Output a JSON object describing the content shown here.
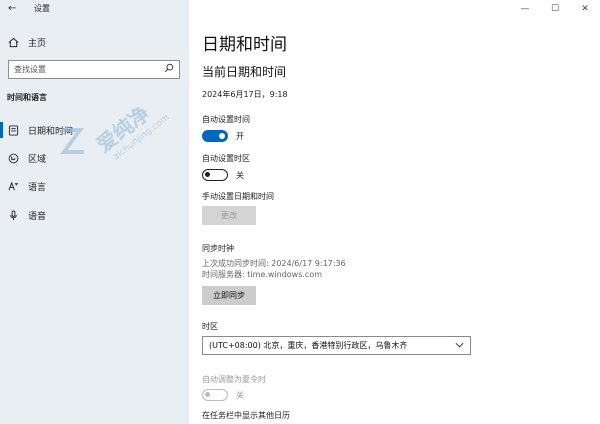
{
  "app": {
    "title": "设置"
  },
  "window": {
    "minimize": "—",
    "maximize": "☐",
    "close": "✕"
  },
  "sidebar": {
    "home_label": "主页",
    "search_placeholder": "查找设置",
    "section_title": "时间和语言",
    "items": [
      {
        "label": "日期和时间",
        "icon": "clock-icon",
        "active": true
      },
      {
        "label": "区域",
        "icon": "globe-icon",
        "active": false
      },
      {
        "label": "语言",
        "icon": "language-icon",
        "active": false
      },
      {
        "label": "语音",
        "icon": "microphone-icon",
        "active": false
      }
    ]
  },
  "main": {
    "page_title": "日期和时间",
    "subheading": "当前日期和时间",
    "current_datetime": "2024年6月17日，9:18",
    "auto_time": {
      "label": "自动设置时间",
      "state": "开",
      "on": true
    },
    "auto_timezone": {
      "label": "自动设置时区",
      "state": "关",
      "on": false
    },
    "manual": {
      "label": "手动设置日期和时间",
      "button": "更改"
    },
    "sync": {
      "heading": "同步时钟",
      "last_sync": "上次成功同步时间: 2024/6/17 9:17:36",
      "server": "时间服务器: time.windows.com",
      "button": "立即同步"
    },
    "timezone": {
      "label": "时区",
      "value": "(UTC+08:00) 北京，重庆，香港特别行政区，乌鲁木齐"
    },
    "dst": {
      "label": "自动调整为夏令时",
      "state": "关"
    },
    "calendar": {
      "label": "在任务栏中显示其他日历"
    }
  },
  "colors": {
    "accent": "#0067c0",
    "sidebar_bg": "#e9eef2"
  }
}
